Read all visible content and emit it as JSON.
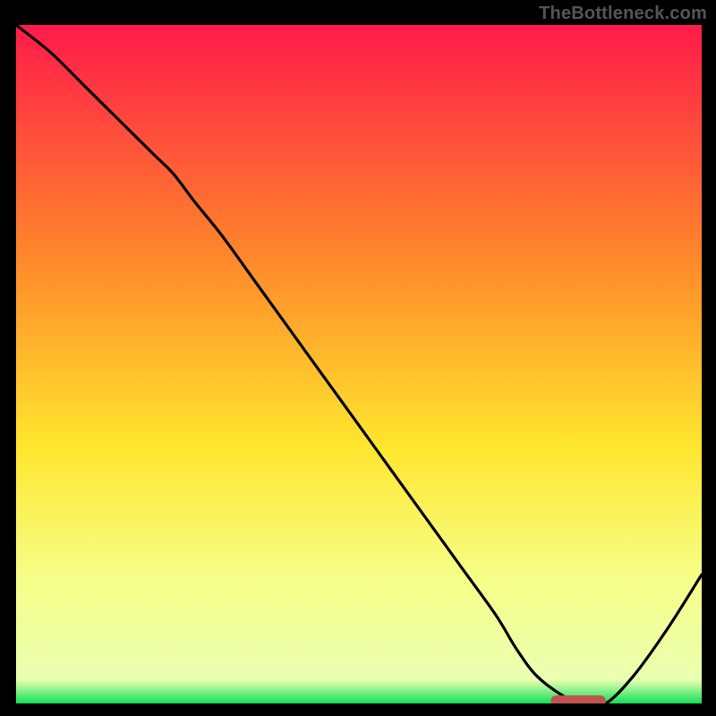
{
  "watermark": "TheBottleneck.com",
  "colors": {
    "gradient_top": "#ff1a4a",
    "gradient_mid1": "#ff8a2a",
    "gradient_mid2": "#ffe62e",
    "gradient_low": "#f6ff8a",
    "gradient_bottom": "#13e05a",
    "curve": "#000000",
    "marker": "#c1544e",
    "frame": "#000000"
  },
  "chart_data": {
    "type": "line",
    "title": "",
    "xlabel": "",
    "ylabel": "",
    "xlim": [
      0,
      100
    ],
    "ylim": [
      0,
      100
    ],
    "series": [
      {
        "name": "bottleneck-curve",
        "x": [
          0,
          5,
          10,
          15,
          20,
          23,
          26,
          30,
          35,
          40,
          45,
          50,
          55,
          60,
          65,
          70,
          73,
          76,
          80,
          83,
          86,
          90,
          95,
          100
        ],
        "y": [
          100,
          96,
          91,
          86,
          81,
          78,
          74,
          69,
          62,
          55,
          48,
          41,
          34,
          27,
          20,
          13,
          8,
          4,
          1,
          0,
          0,
          4,
          11,
          19
        ]
      }
    ],
    "marker": {
      "x_start": 78,
      "x_end": 86,
      "y": 0
    },
    "gradient_stops": [
      {
        "offset": 0.0,
        "color": "#ff1a4a"
      },
      {
        "offset": 0.35,
        "color": "#ff8a2a"
      },
      {
        "offset": 0.62,
        "color": "#ffe62e"
      },
      {
        "offset": 0.82,
        "color": "#f6ff8a"
      },
      {
        "offset": 0.965,
        "color": "#eaffb0"
      },
      {
        "offset": 1.0,
        "color": "#13e05a"
      }
    ]
  }
}
